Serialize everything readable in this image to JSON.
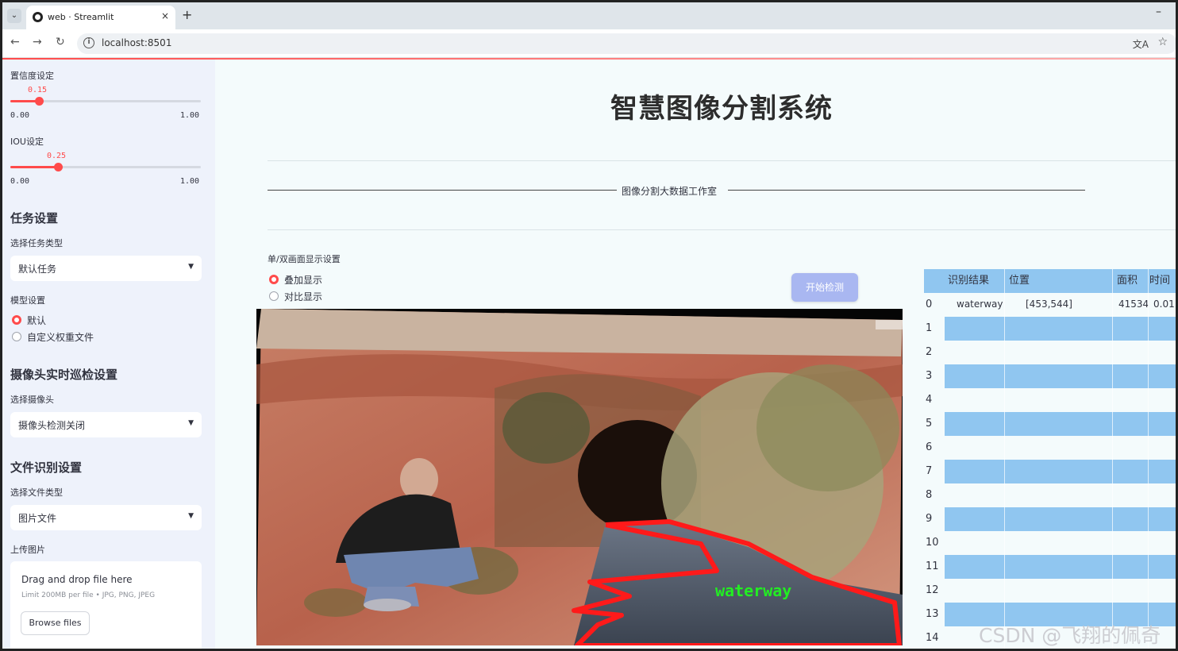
{
  "browser": {
    "tab_title": "web · Streamlit",
    "url": "localhost:8501",
    "menu_glyph": "⌄",
    "close_glyph": "×",
    "new_tab_glyph": "+",
    "minimize_glyph": "–",
    "back_glyph": "←",
    "forward_glyph": "→",
    "reload_glyph": "↻",
    "info_glyph": "i",
    "translate_glyph": "文A",
    "star_glyph": "☆"
  },
  "sidebar": {
    "confidence": {
      "label": "置信度设定",
      "value": "0.15",
      "min": "0.00",
      "max": "1.00",
      "fraction": 0.15
    },
    "iou": {
      "label": "IOU设定",
      "value": "0.25",
      "min": "0.00",
      "max": "1.00",
      "fraction": 0.25
    },
    "task_heading": "任务设置",
    "task_type_label": "选择任务类型",
    "task_type_value": "默认任务",
    "model_label": "模型设置",
    "model_options": [
      "默认",
      "自定义权重文件"
    ],
    "model_selected": "默认",
    "camera_heading": "摄像头实时巡检设置",
    "camera_label": "选择摄像头",
    "camera_value": "摄像头检测关闭",
    "file_heading": "文件识别设置",
    "file_type_label": "选择文件类型",
    "file_type_value": "图片文件",
    "upload_label": "上传图片",
    "upload_drop": "Drag and drop file here",
    "upload_limit": "Limit 200MB per file • JPG, PNG, JPEG",
    "browse_button": "Browse files",
    "caret": "▼"
  },
  "main": {
    "title": "智慧图像分割系统",
    "studio": "图像分割大数据工作室",
    "display_mode_label": "单/双画面显示设置",
    "display_options": [
      "叠加显示",
      "对比显示"
    ],
    "display_selected": "叠加显示",
    "start_button": "开始检测",
    "detection_label": "waterway"
  },
  "table": {
    "columns": [
      "识别结果",
      "位置",
      "面积",
      "时间"
    ],
    "rows": [
      {
        "index": "0",
        "result": "waterway",
        "position": "[453,544]",
        "area": "41534",
        "time": "0.01"
      },
      {
        "index": "1"
      },
      {
        "index": "2"
      },
      {
        "index": "3"
      },
      {
        "index": "4"
      },
      {
        "index": "5"
      },
      {
        "index": "6"
      },
      {
        "index": "7"
      },
      {
        "index": "8"
      },
      {
        "index": "9"
      },
      {
        "index": "10"
      },
      {
        "index": "11"
      },
      {
        "index": "12"
      },
      {
        "index": "13"
      },
      {
        "index": "14"
      }
    ]
  },
  "watermark": "CSDN @飞翔的佩奇",
  "colors": {
    "accent": "#ff4b4b",
    "table_stripe": "#90c6f0",
    "start_button": "#a9b7f1",
    "sidebar": "#eef2fb",
    "mask_outline": "#ff1a1a",
    "mask_label": "#22ee22"
  }
}
